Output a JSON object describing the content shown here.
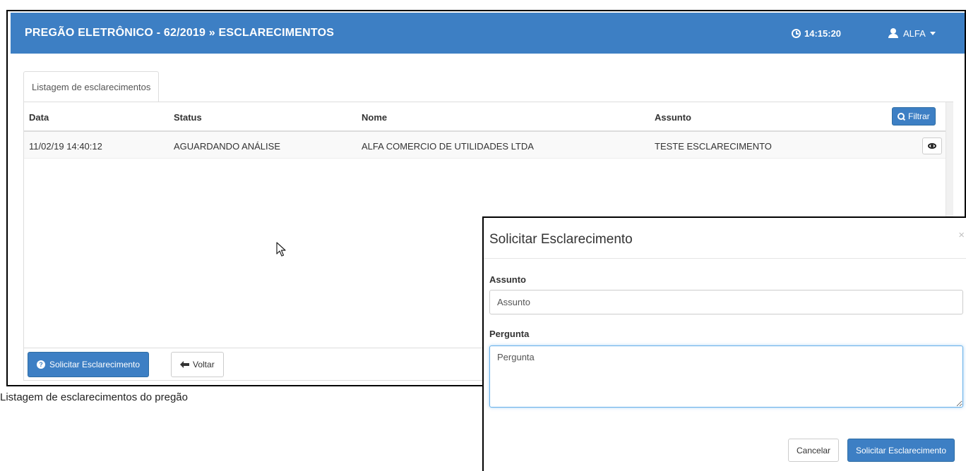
{
  "header": {
    "title": "PREGÃO ELETRÔNICO - 62/2019 » ESCLARECIMENTOS",
    "clock": "14:15:20",
    "user": "ALFA"
  },
  "tab": {
    "label": "Listagem de esclarecimentos"
  },
  "table": {
    "columns": [
      "Data",
      "Status",
      "Nome",
      "Assunto"
    ],
    "filter_label": "Filtrar",
    "rows": [
      {
        "data": "11/02/19 14:40:12",
        "status": "AGUARDANDO ANÁLISE",
        "nome": "ALFA COMERCIO DE UTILIDADES LTDA",
        "assunto": "TESTE ESCLARECIMENTO"
      }
    ]
  },
  "footer": {
    "solicitar_label": "Solicitar Esclarecimento",
    "voltar_label": "Voltar"
  },
  "caption": "Listagem de esclarecimentos do pregão",
  "modal": {
    "title": "Solicitar Esclarecimento",
    "close": "×",
    "assunto_label": "Assunto",
    "assunto_placeholder": "Assunto",
    "pergunta_label": "Pergunta",
    "pergunta_placeholder": "Pergunta",
    "cancel_label": "Cancelar",
    "submit_label": "Solicitar Esclarecimento"
  },
  "colors": {
    "primary": "#3d7fc4",
    "focus": "#66afe9"
  }
}
